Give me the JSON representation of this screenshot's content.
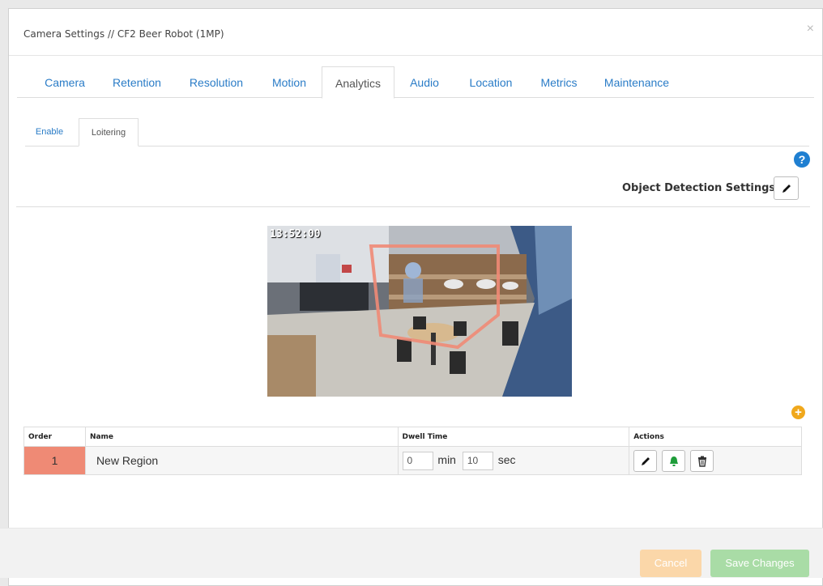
{
  "modal": {
    "title": "Camera Settings // CF2 Beer Robot (1MP)",
    "close_glyph": "×"
  },
  "tabs": [
    {
      "label": "Camera",
      "active": false
    },
    {
      "label": "Retention",
      "active": false
    },
    {
      "label": "Resolution",
      "active": false
    },
    {
      "label": "Motion",
      "active": false
    },
    {
      "label": "Analytics",
      "active": true
    },
    {
      "label": "Audio",
      "active": false
    },
    {
      "label": "Location",
      "active": false
    },
    {
      "label": "Metrics",
      "active": false
    },
    {
      "label": "Maintenance",
      "active": false
    }
  ],
  "subtabs": [
    {
      "label": "Enable",
      "active": false
    },
    {
      "label": "Loitering",
      "active": true
    }
  ],
  "help_glyph": "?",
  "object_detection": {
    "label": "Object Detection Settings",
    "icon": "pencil-icon"
  },
  "camera": {
    "timestamp": "13:52:00",
    "region_color": "#f08a75"
  },
  "add_glyph": "+",
  "table": {
    "headers": {
      "order": "Order",
      "name": "Name",
      "dwell": "Dwell Time",
      "actions": "Actions"
    },
    "rows": [
      {
        "order": "1",
        "name": "New Region",
        "dwell_min": "0",
        "min_unit": "min",
        "dwell_sec": "10",
        "sec_unit": "sec"
      }
    ]
  },
  "footer": {
    "cancel": "Cancel",
    "save": "Save Changes"
  },
  "colors": {
    "link": "#2a7cc7",
    "order_highlight": "#ef8a75",
    "bell": "#1f9d3a",
    "help": "#1f7fd1",
    "add": "#f0a81c"
  }
}
